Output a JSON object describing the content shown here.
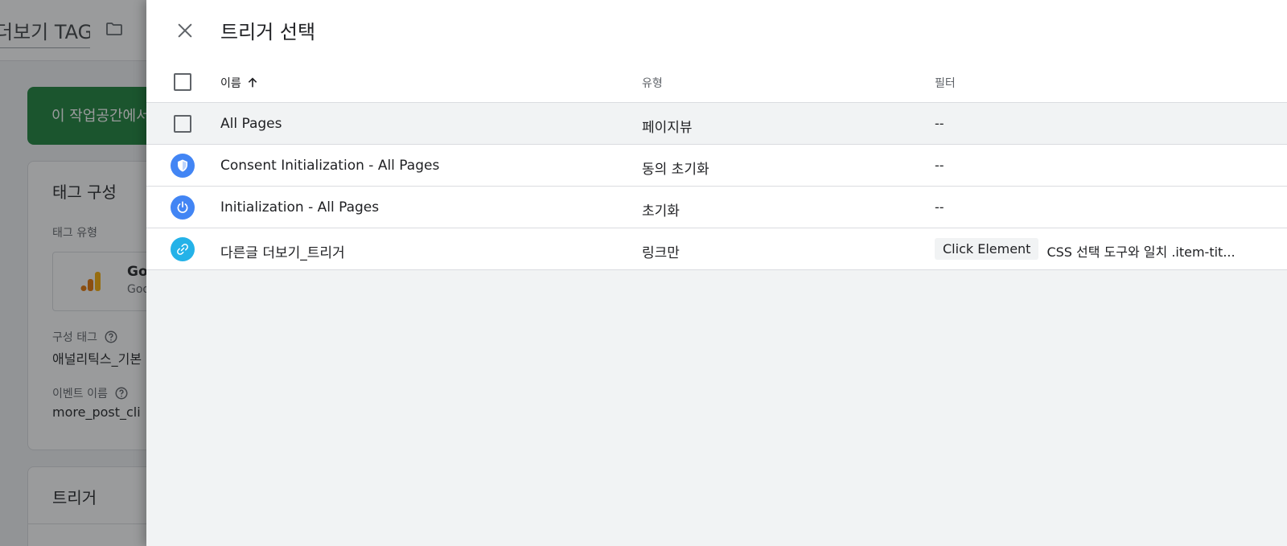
{
  "background": {
    "title": "더보기 TAG",
    "banner_text": "이 작업공간에서",
    "tag_config": {
      "title": "태그 구성",
      "tag_type_label": "태그 유형",
      "tag_type_name": "Go",
      "tag_type_sub": "Goo",
      "config_tag_label": "구성 태그",
      "config_tag_value": "애널리틱스_기본",
      "event_name_label": "이벤트 이름",
      "event_name_value": "more_post_cli"
    },
    "trigger_card": {
      "title": "트리거"
    }
  },
  "drawer": {
    "title": "트리거 선택",
    "columns": {
      "name": "이름",
      "type": "유형",
      "filter": "필터"
    },
    "rows": [
      {
        "name": "All Pages",
        "type": "페이지뷰",
        "filter": "--",
        "icon": "checkbox"
      },
      {
        "name": "Consent Initialization - All Pages",
        "type": "동의 초기화",
        "filter": "--",
        "icon": "shield-icon",
        "color": "#4285f4"
      },
      {
        "name": "Initialization - All Pages",
        "type": "초기화",
        "filter": "--",
        "icon": "power-icon",
        "color": "#4285f4"
      },
      {
        "name": "다른글 더보기_트리거",
        "type": "링크만",
        "filter_chip": "Click Element",
        "filter": "CSS 선택 도구와 일치 .item-tit...",
        "icon": "link-icon",
        "color": "#24b2e8"
      }
    ]
  },
  "colors": {
    "banner": "#188038",
    "primary_blue": "#4285f4",
    "link_blue": "#24b2e8"
  }
}
